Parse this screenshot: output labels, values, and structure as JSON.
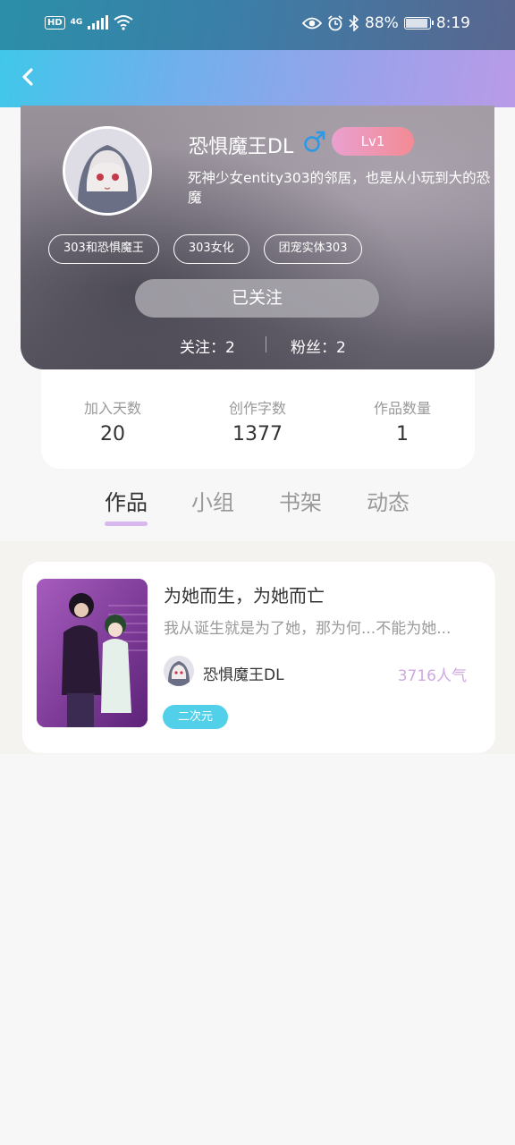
{
  "status_bar": {
    "hd": "HD",
    "network": "4G",
    "battery": "88%",
    "time": "8:19"
  },
  "nav": {
    "back_icon": "chevron-left-icon"
  },
  "profile": {
    "username": "恐惧魔王DL",
    "gender_icon": "male-icon",
    "level": "Lv1",
    "bio": "死神少女entity303的邻居，也是从小玩到大的恐魔",
    "tags": [
      "303和恐惧魔王",
      "303女化",
      "团宠实体303"
    ],
    "follow_button": "已关注",
    "following": "关注：2",
    "fans": "粉丝：2"
  },
  "stats": [
    {
      "label": "加入天数",
      "value": "20"
    },
    {
      "label": "创作字数",
      "value": "1377"
    },
    {
      "label": "作品数量",
      "value": "1"
    }
  ],
  "tabs": [
    "作品",
    "小组",
    "书架",
    "动态"
  ],
  "active_tab": "作品",
  "works": [
    {
      "title": "为她而生，为她而亡",
      "description": "我从诞生就是为了她，那为何...不能为她...",
      "author": "恐惧魔王DL",
      "popularity": "3716人气",
      "genre": "二次元"
    }
  ],
  "colors": {
    "accent_lavender": "#d6b7ee",
    "popularity": "#cfa8e0",
    "genre_tag": "#52cfe9",
    "level_badge": "#f38b94"
  }
}
